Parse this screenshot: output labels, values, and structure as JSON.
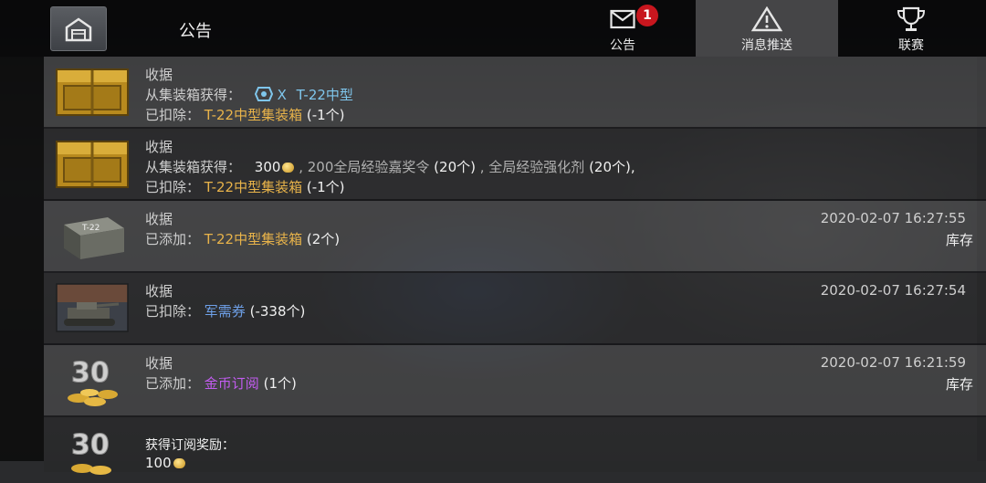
{
  "header": {
    "title": "公告",
    "tabs": [
      {
        "label": "公告",
        "icon": "mail-icon",
        "badge": "1",
        "active": false
      },
      {
        "label": "消息推送",
        "icon": "warning-icon",
        "active": true
      },
      {
        "label": "联赛",
        "icon": "trophy-icon",
        "active": false
      }
    ]
  },
  "messages": [
    {
      "title": "收据",
      "line2_label": "从集装箱获得：",
      "line2_item": "T-22中型",
      "line2_marker": "X",
      "line3_label": "已扣除：",
      "line3_item": "T-22中型集装箱",
      "line3_qty": "(-1个)",
      "icon": "gold-crate-icon"
    },
    {
      "title": "收据",
      "line2_label": "从集装箱获得：",
      "line2_amount": "300",
      "line2_rest_a": ", 200全局经验嘉奖令",
      "line2_rest_b": "(20个)",
      "line2_rest_c": ", 全局经验强化剂",
      "line2_rest_d": "(20个),",
      "line3_label": "已扣除：",
      "line3_item": "T-22中型集装箱",
      "line3_qty": "(-1个)",
      "icon": "gold-crate-icon"
    },
    {
      "title": "收据",
      "line2_label": "已添加：",
      "line2_item": "T-22中型集装箱",
      "line2_qty": "(2个)",
      "timestamp": "2020-02-07 16:27:55",
      "status": "库存",
      "icon": "t22-crate-icon"
    },
    {
      "title": "收据",
      "line2_label": "已扣除：",
      "line2_item": "军需券",
      "line2_qty": "(-338个)",
      "timestamp": "2020-02-07 16:27:54",
      "icon": "tank-ticket-icon"
    },
    {
      "title": "收据",
      "line2_label": "已添加：",
      "line2_item": "金币订阅",
      "line2_qty": "(1个)",
      "timestamp": "2020-02-07 16:21:59",
      "status": "库存",
      "icon": "gold-subscription-icon",
      "icon_text": "30"
    },
    {
      "title": "获得订阅奖励：",
      "line2_amount": "100",
      "icon": "gold-subscription-icon",
      "icon_text": "30"
    }
  ],
  "colors": {
    "item_gold": "#e8b34a",
    "item_blue": "#6ea0e8",
    "item_purple": "#c25cf0",
    "badge_red": "#c8161e"
  }
}
